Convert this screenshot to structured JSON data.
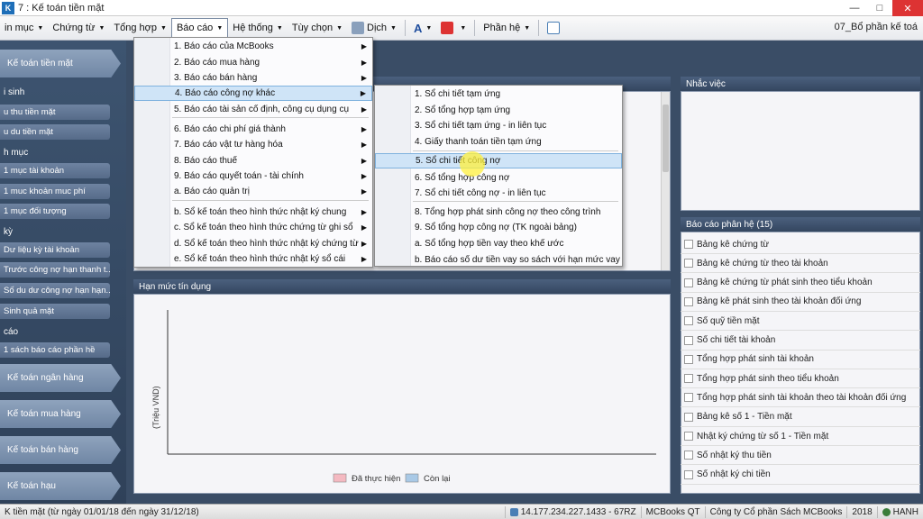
{
  "window": {
    "app_icon": "K",
    "title": "7 : Kế toán tiền mặt"
  },
  "menubar": {
    "items": [
      "in mục",
      "Chứng từ",
      "Tổng hợp",
      "Báo cáo",
      "Hệ thống",
      "Tùy chọn",
      "Dịch"
    ],
    "share": "Phần hệ",
    "right_text": "07_Bổ phần kế toá"
  },
  "sidebar": {
    "top_button": "Kế toán tiền mặt",
    "section_1": "i sinh",
    "section_2": "h mục",
    "section_3": "kỳ",
    "section_4": "cáo",
    "items": [
      "u thu tiền mặt",
      "u du tiền mặt",
      "1 mục tài khoản",
      "1 muc khoản muc phí",
      "1 mục đối tượng",
      "Dư liệu kỳ tài khoản",
      "Trước công nợ hạn thanh t...",
      "Số du dư công nợ hạn hạn...",
      "Sinh quả mặt",
      "1 sách báo cáo phần hề"
    ],
    "modules": [
      "Kế toán ngân hàng",
      "Kế toán mua hàng",
      "Kế toán bán hàng",
      "Kế toán hạu"
    ]
  },
  "menu_bao_cao": {
    "items": [
      "1. Báo cáo của McBooks",
      "2. Báo cáo mua hàng",
      "3. Báo cáo bán hàng",
      "4. Báo cáo công nợ khác",
      "5. Báo cáo tài sản cố định, công cụ dụng cụ",
      "6. Báo cáo chi phí giá thành",
      "7. Báo cáo vật tư hàng hóa",
      "8. Báo cáo thuế",
      "9. Báo cáo quyết toán - tài chính",
      "a. Báo cáo quản trị",
      "b. Sổ kế toán theo hình thức nhật ký chung",
      "c. Sổ kế toán theo hình thức chứng từ ghi sổ",
      "d. Sổ kế toán theo hình thức nhật ký chứng từ",
      "e. Sổ kế toán theo hình thức nhật ký sổ cái"
    ]
  },
  "submenu_cong_no": {
    "items": [
      "1. Sổ chi tiết tạm ứng",
      "2. Sổ tổng hợp tạm ứng",
      "3. Sổ chi tiết tạm ứng - in liên tục",
      "4. Giấy thanh toán tiền tạm ứng",
      "5. Sổ chi tiết công nợ",
      "6. Sổ tổng hợp công nợ",
      "7. Sổ chi tiết công nợ - in liên tục",
      "8. Tổng hợp phát sinh công nợ theo công trình",
      "9. Sổ tổng hợp công nợ (TK ngoài bảng)",
      "a. Sổ tổng hợp tiền vay theo khế ước",
      "b. Báo cáo số dư tiền vay so sách với hạn mức vay"
    ]
  },
  "panels": {
    "reminder_title": "Nhắc việc",
    "credit_title": "Hạn mức tín dụng",
    "reports_title": "Báo cáo phân hệ (15)"
  },
  "chart_data": {
    "type": "bar",
    "ylabel": "(Triệu VND)",
    "series": [
      {
        "name": "Đã thực hiện",
        "color": "#f4b9c1",
        "values": []
      },
      {
        "name": "Còn lại",
        "color": "#a9c9e6",
        "values": []
      }
    ]
  },
  "reports": [
    "Bảng kê chứng từ",
    "Bảng kê chứng từ theo tài khoản",
    "Bảng kê chứng từ phát sinh theo tiểu khoản",
    "Bảng kê phát sinh theo tài khoản đối ứng",
    "Số quỹ tiền mặt",
    "Số chi tiết tài khoản",
    "Tổng hợp phát sinh tài khoản",
    "Tổng hợp phát sinh theo tiểu khoản",
    "Tổng hợp phát sinh tài khoản theo tài khoản đối ứng",
    "Bảng kê số 1 - Tiền mặt",
    "Nhật ký chứng từ số 1 - Tiền mặt",
    "Số nhật ký thu tiền",
    "Số nhật ký chi tiền"
  ],
  "statusbar": {
    "left": "K tiền mặt (từ ngày 01/01/18 đến ngày 31/12/18)",
    "ip": "14.177.234.227.1433 - 67RZ",
    "app": "MCBooks QT",
    "company": "Công ty Cổ phần Sách MCBooks",
    "year": "2018",
    "user": "HANH"
  }
}
